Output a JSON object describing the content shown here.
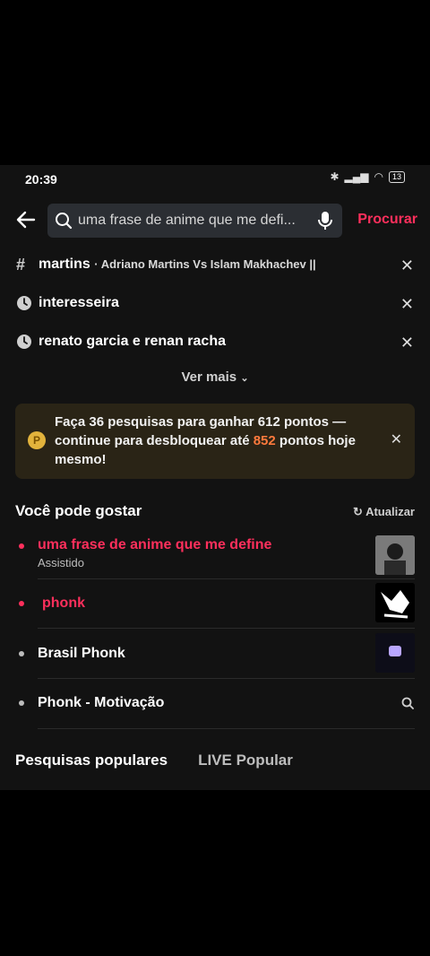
{
  "status_bar": {
    "time": "20:39",
    "battery": "13"
  },
  "search": {
    "query": "uma frase de anime que me defi...",
    "submit_label": "Procurar"
  },
  "history": [
    {
      "label": "martins",
      "sub": "· Adriano Martins Vs Islam Makhachev ||",
      "icon": "hashtag-icon"
    },
    {
      "label": "interesseira",
      "sub": "",
      "icon": "clock-icon"
    },
    {
      "label": "renato garcia e renan racha",
      "sub": "",
      "icon": "clock-icon"
    }
  ],
  "ver_mais": "Ver mais",
  "banner": {
    "text_before": "Faça 36 pesquisas para ganhar 612 pontos — continue para desbloquear até ",
    "highlight": "852",
    "text_after": " pontos hoje mesmo!"
  },
  "suggestions_title": "Você pode gostar",
  "refresh_label": "Atualizar",
  "suggestions": [
    {
      "label": "uma frase de anime que me define",
      "sub": "Assistido",
      "color": "#ff2f5c"
    },
    {
      "label": "phonk",
      "sub": "",
      "color": "#ff2f5c"
    },
    {
      "label": "Brasil Phonk",
      "sub": "",
      "color": "#ffffff"
    },
    {
      "label": "Phonk - Motivação",
      "sub": "",
      "color": "#ffffff"
    }
  ],
  "tabs": [
    "Pesquisas populares",
    "LIVE Popular"
  ],
  "colors": {
    "accent": "#ff2f5c",
    "highlight": "#ff7a3d",
    "background": "#121212"
  }
}
